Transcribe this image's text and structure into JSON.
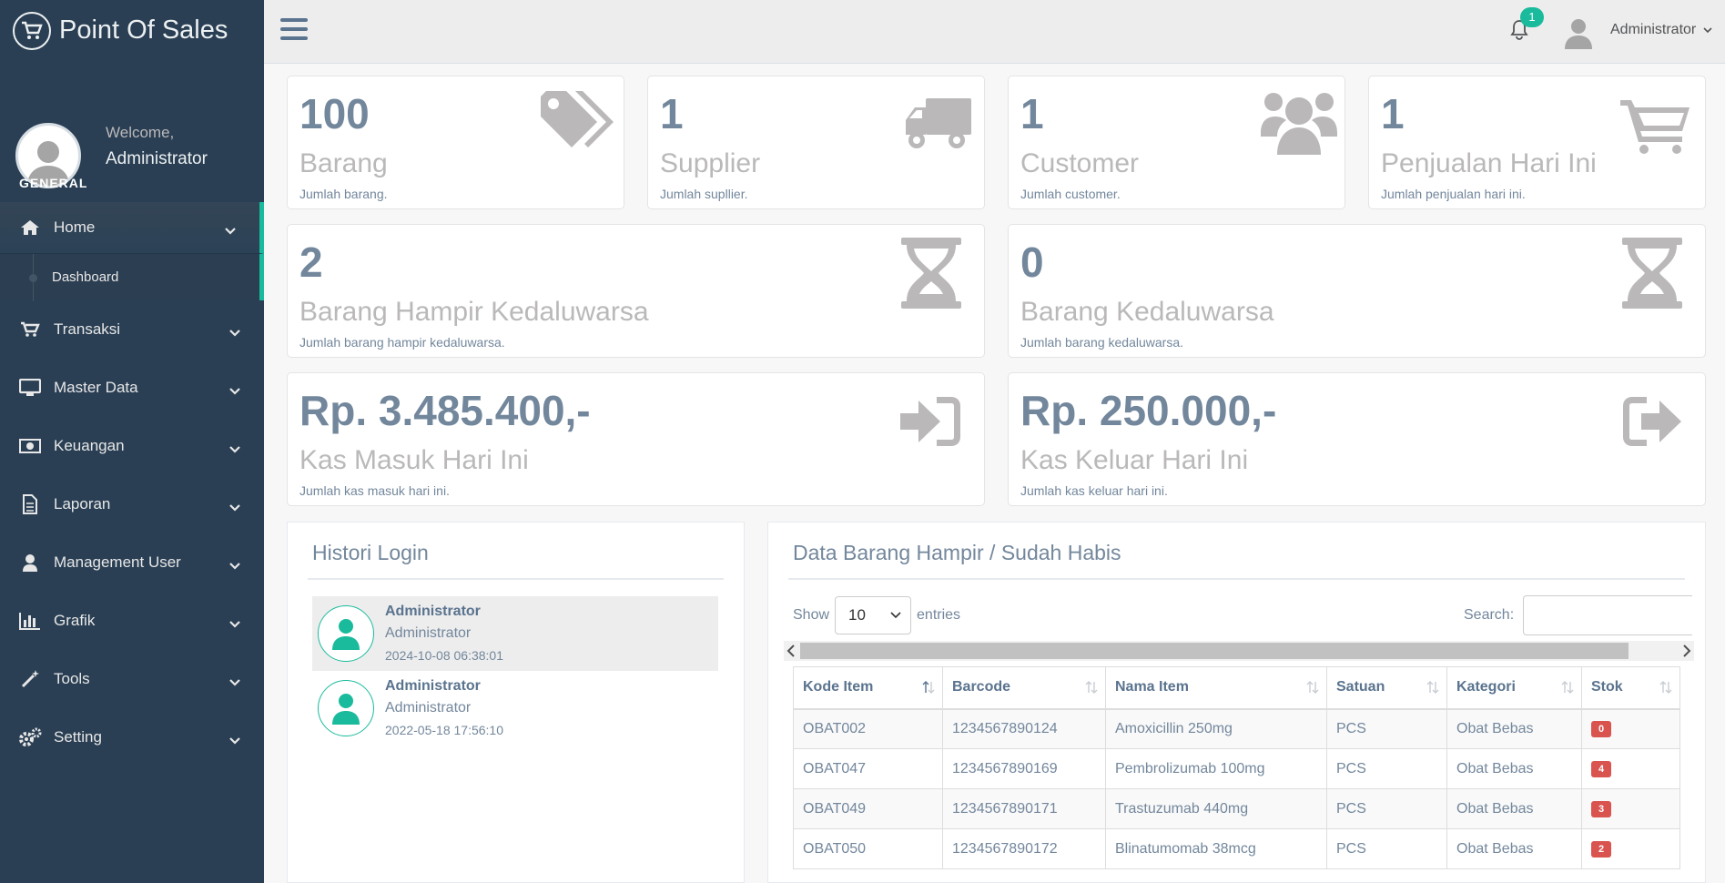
{
  "brand": {
    "title": "Point Of Sales"
  },
  "profile": {
    "welcome": "Welcome,",
    "name": "Administrator"
  },
  "sidebar": {
    "section_title": "GENERAL",
    "items": [
      {
        "label": "Home",
        "icon": "home-icon"
      },
      {
        "label": "Transaksi",
        "icon": "cart-icon"
      },
      {
        "label": "Master Data",
        "icon": "desktop-icon"
      },
      {
        "label": "Keuangan",
        "icon": "money-icon"
      },
      {
        "label": "Laporan",
        "icon": "file-icon"
      },
      {
        "label": "Management User",
        "icon": "user-icon"
      },
      {
        "label": "Grafik",
        "icon": "bar-chart-icon"
      },
      {
        "label": "Tools",
        "icon": "magic-wand-icon"
      },
      {
        "label": "Setting",
        "icon": "gears-icon"
      }
    ],
    "submenu": {
      "label": "Dashboard"
    }
  },
  "topnav": {
    "notification_count": "1",
    "user_name": "Administrator"
  },
  "tiles": [
    {
      "count": "100",
      "label": "Barang",
      "desc": "Jumlah barang.",
      "icon": "tags-icon"
    },
    {
      "count": "1",
      "label": "Supplier",
      "desc": "Jumlah supllier.",
      "icon": "truck-icon"
    },
    {
      "count": "1",
      "label": "Customer",
      "desc": "Jumlah customer.",
      "icon": "users-icon"
    },
    {
      "count": "1",
      "label": "Penjualan Hari Ini",
      "desc": "Jumlah penjualan hari ini.",
      "icon": "cart-icon"
    },
    {
      "count": "2",
      "label": "Barang Hampir Kedaluwarsa",
      "desc": "Jumlah barang hampir kedaluwarsa.",
      "icon": "hourglass-icon"
    },
    {
      "count": "0",
      "label": "Barang Kedaluwarsa",
      "desc": "Jumlah barang kedaluwarsa.",
      "icon": "hourglass-icon"
    },
    {
      "count": "Rp. 3.485.400,-",
      "label": "Kas Masuk Hari Ini",
      "desc": "Jumlah kas masuk hari ini.",
      "icon": "sign-in-icon"
    },
    {
      "count": "Rp. 250.000,-",
      "label": "Kas Keluar Hari Ini",
      "desc": "Jumlah kas keluar hari ini.",
      "icon": "sign-out-icon"
    }
  ],
  "login_history": {
    "title": "Histori Login",
    "items": [
      {
        "name": "Administrator",
        "role": "Administrator",
        "time": "2024-10-08 06:38:01"
      },
      {
        "name": "Administrator",
        "role": "Administrator",
        "time": "2022-05-18 17:56:10"
      }
    ]
  },
  "stock_table": {
    "title": "Data Barang Hampir / Sudah Habis",
    "show_label": "Show",
    "entries_value": "10",
    "entries_label": "entries",
    "search_label": "Search:",
    "columns": [
      "Kode Item",
      "Barcode",
      "Nama Item",
      "Satuan",
      "Kategori",
      "Stok"
    ],
    "rows": [
      [
        "OBAT002",
        "1234567890124",
        "Amoxicillin 250mg",
        "PCS",
        "Obat Bebas",
        "0"
      ],
      [
        "OBAT047",
        "1234567890169",
        "Pembrolizumab 100mg",
        "PCS",
        "Obat Bebas",
        "4"
      ],
      [
        "OBAT049",
        "1234567890171",
        "Trastuzumab 440mg",
        "PCS",
        "Obat Bebas",
        "3"
      ],
      [
        "OBAT050",
        "1234567890172",
        "Blinatumomab 38mcg",
        "PCS",
        "Obat Bebas",
        "2"
      ]
    ]
  },
  "colors": {
    "sidebar": "#2A3F54",
    "accent": "#1ABB9C",
    "danger": "#D9534F",
    "text": "#73879C"
  }
}
